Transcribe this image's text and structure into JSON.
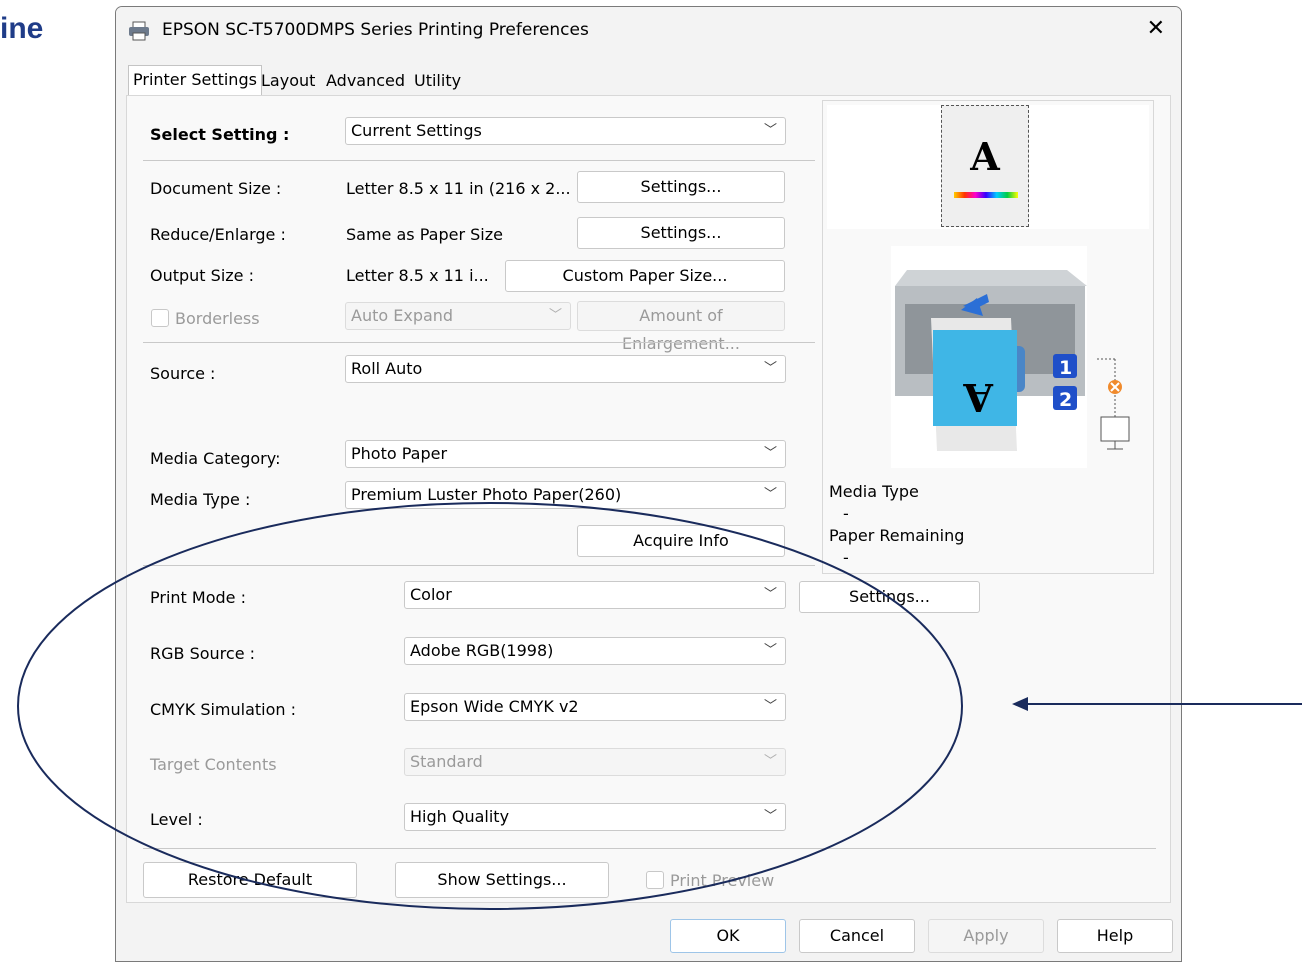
{
  "background_fragment": "ine",
  "window": {
    "title": "EPSON SC-T5700DMPS Series Printing Preferences",
    "close": "✕"
  },
  "tabs": [
    {
      "label": "Printer Settings"
    },
    {
      "label": "Layout"
    },
    {
      "label": "Advanced"
    },
    {
      "label": "Utility"
    }
  ],
  "select_setting": {
    "label": "Select Setting :",
    "value": "Current Settings"
  },
  "document_size": {
    "label": "Document Size :",
    "value": "Letter 8.5 x 11 in (216 x 2...",
    "button": "Settings..."
  },
  "reduce_enlarge": {
    "label": "Reduce/Enlarge :",
    "value": "Same as Paper Size",
    "button": "Settings..."
  },
  "output_size": {
    "label": "Output Size :",
    "value": "Letter 8.5 x 11 i...",
    "button": "Custom Paper Size..."
  },
  "borderless": {
    "label": "Borderless",
    "mode": "Auto Expand",
    "button": "Amount of Enlargement..."
  },
  "source": {
    "label": "Source :",
    "value": "Roll Auto"
  },
  "media_category": {
    "label": "Media Category:",
    "value": "Photo Paper"
  },
  "media_type": {
    "label": "Media Type :",
    "value": "Premium Luster Photo Paper(260)"
  },
  "acquire_info": "Acquire Info",
  "print_mode": {
    "label": "Print Mode :",
    "value": "Color",
    "button": "Settings..."
  },
  "rgb_source": {
    "label": "RGB Source :",
    "value": "Adobe RGB(1998)"
  },
  "cmyk_simulation": {
    "label": "CMYK Simulation :",
    "value": "Epson Wide CMYK v2"
  },
  "target_contents": {
    "label": "Target Contents",
    "value": "Standard"
  },
  "level": {
    "label": "Level :",
    "value": "High Quality"
  },
  "preview_panel": {
    "page_letter": "A",
    "media_type_label": "Media Type",
    "media_type_value": "-",
    "paper_remaining_label": "Paper Remaining",
    "paper_remaining_value": "-",
    "roll_1": "1",
    "roll_2": "2",
    "output_letter": "A"
  },
  "footer": {
    "restore_default": "Restore Default",
    "show_settings": "Show Settings...",
    "print_preview": "Print Preview"
  },
  "dialog_buttons": {
    "ok": "OK",
    "cancel": "Cancel",
    "apply": "Apply",
    "help": "Help"
  },
  "colors": {
    "annotation": "#1a2b5c",
    "accent_blue": "#1f6fd1",
    "cyan_paper": "#3fb6e6"
  }
}
